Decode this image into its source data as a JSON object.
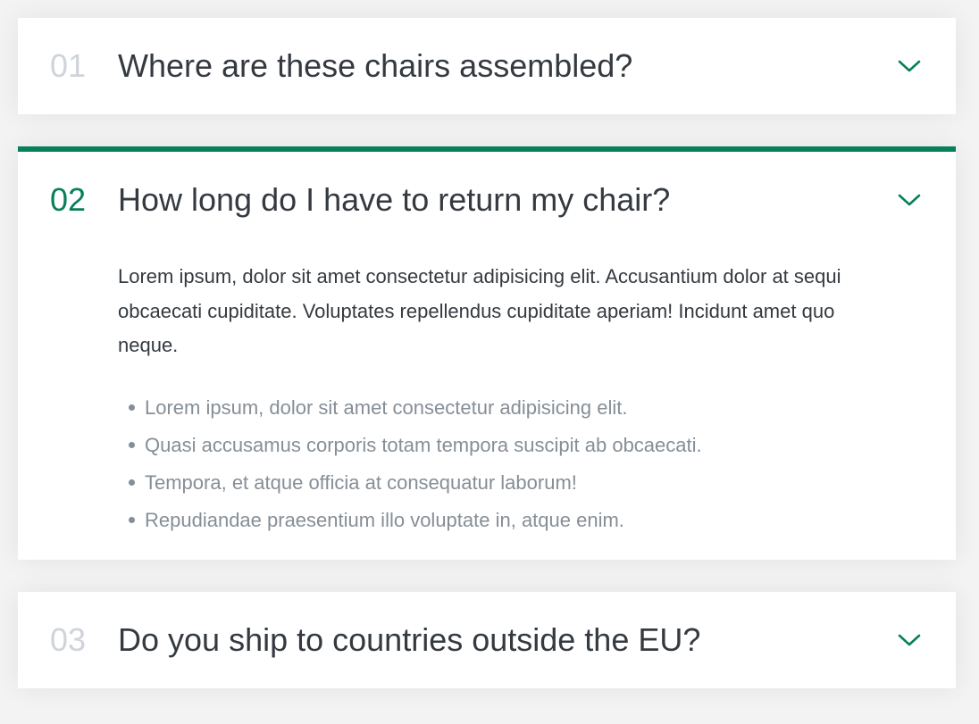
{
  "colors": {
    "accent": "#087f5b",
    "muted_number": "#ced4da",
    "text": "#343a40",
    "list_text": "#868e96"
  },
  "faq": {
    "items": [
      {
        "number": "01",
        "question": "Where are these chairs assembled?",
        "expanded": false,
        "icon": "chevron-down-icon"
      },
      {
        "number": "02",
        "question": "How long do I have to return my chair?",
        "expanded": true,
        "icon": "chevron-down-icon",
        "answer": "Lorem ipsum, dolor sit amet consectetur adipisicing elit. Accusantium dolor at sequi obcaecati cupiditate. Voluptates repellendus cupiditate aperiam! Incidunt amet quo neque.",
        "bullets": [
          "Lorem ipsum, dolor sit amet consectetur adipisicing elit.",
          "Quasi accusamus corporis totam tempora suscipit ab obcaecati.",
          "Tempora, et atque officia at consequatur laborum!",
          "Repudiandae praesentium illo voluptate in, atque enim."
        ]
      },
      {
        "number": "03",
        "question": "Do you ship to countries outside the EU?",
        "expanded": false,
        "icon": "chevron-down-icon"
      }
    ]
  }
}
